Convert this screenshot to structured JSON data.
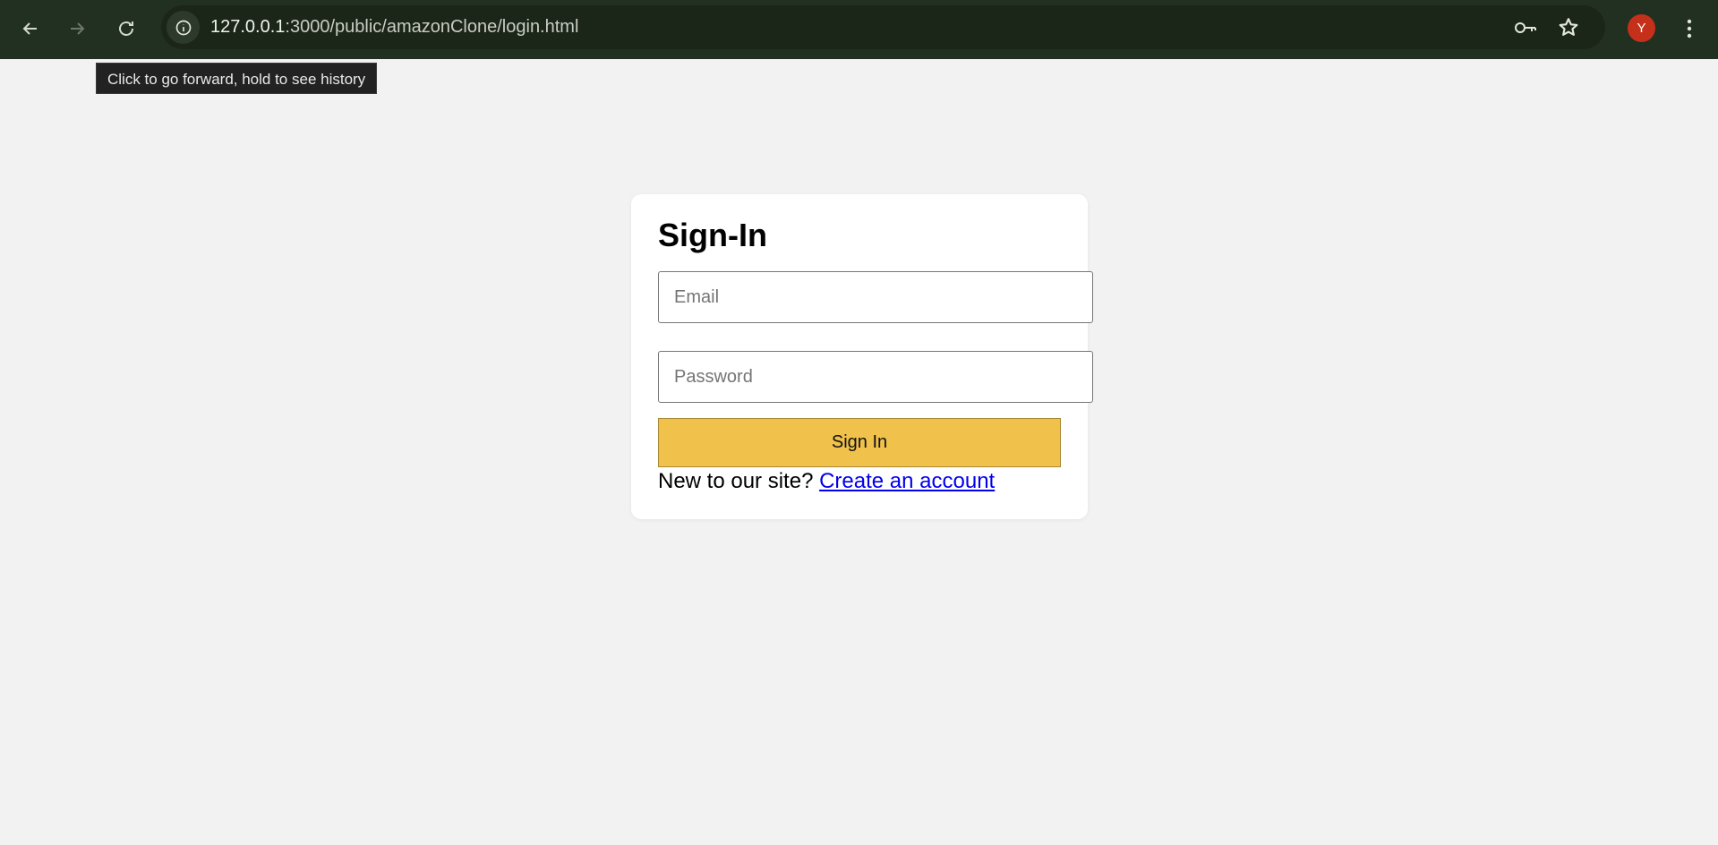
{
  "browser": {
    "url_host": "127.0.0.1",
    "url_rest": ":3000/public/amazonClone/login.html",
    "profile_initial": "Y",
    "tooltip": "Click to go forward, hold to see history",
    "icons": {
      "back": "arrow-left-icon",
      "forward": "arrow-right-icon",
      "reload": "reload-icon",
      "site_info": "info-circle-icon",
      "password": "key-icon",
      "bookmark": "star-icon",
      "menu": "kebab-menu-icon"
    },
    "colors": {
      "toolbar": "#223021",
      "omnibox": "#1b2618",
      "avatar": "#c5301a"
    }
  },
  "login": {
    "title": "Sign-In",
    "email_placeholder": "Email",
    "password_placeholder": "Password",
    "signin_label": "Sign In",
    "new_prompt": "New to our site?",
    "create_link": "Create an account",
    "colors": {
      "button": "#f0c14b",
      "link": "#0000ee",
      "background": "#f2f2f2"
    }
  }
}
